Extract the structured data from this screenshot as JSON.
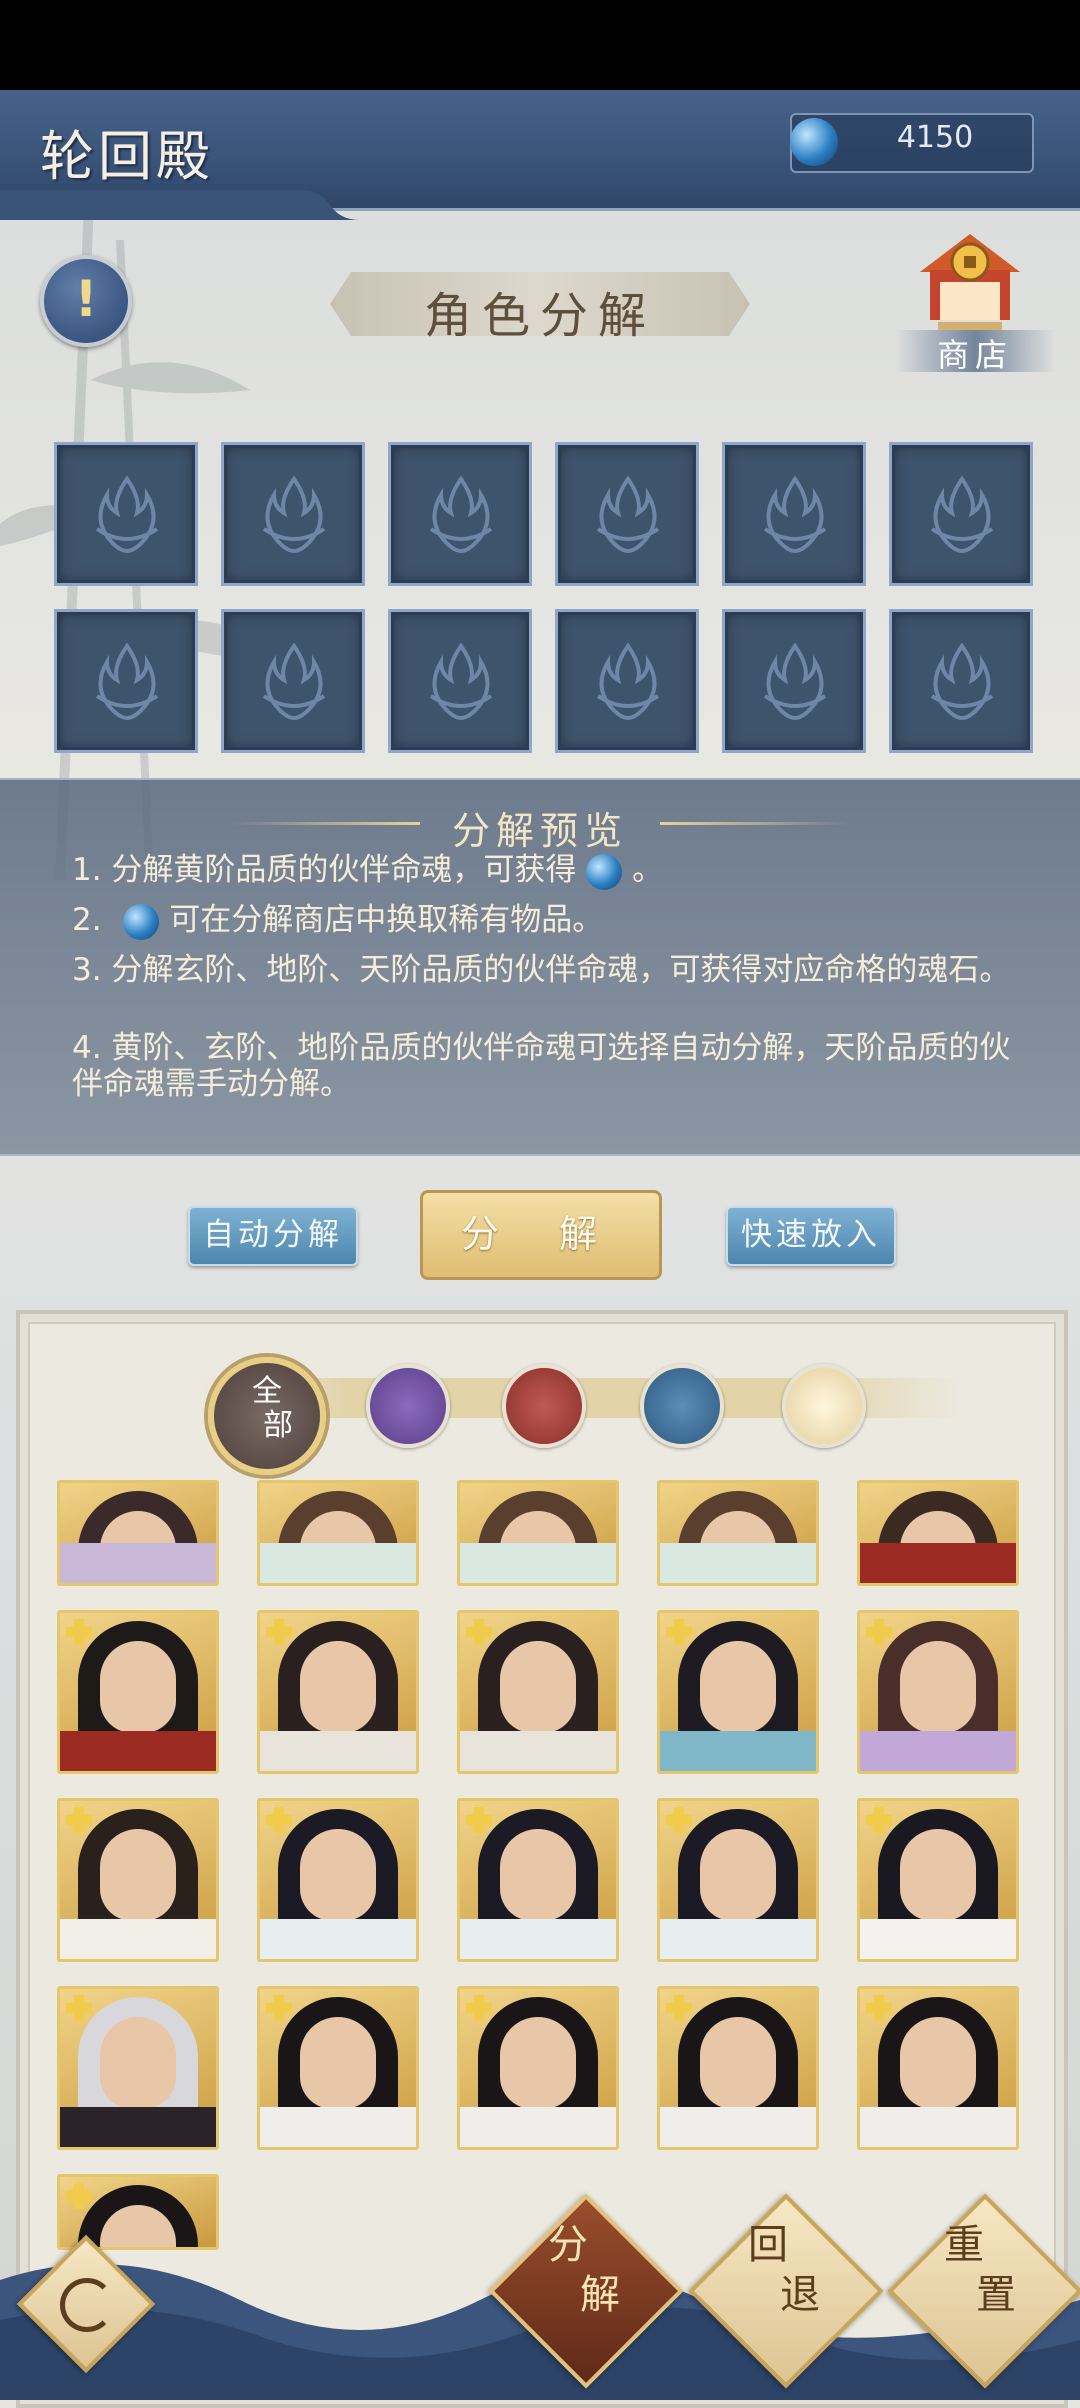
{
  "header": {
    "title": "轮回殿",
    "currency_value": "4150"
  },
  "info_button": {
    "glyph": "!"
  },
  "section_title": "角色分解",
  "shop": {
    "label": "商店"
  },
  "slots_count": 12,
  "preview": {
    "title": "分解预览",
    "line1_a": "1. 分解黄阶品质的伙伴命魂，可获得",
    "line1_b": "。",
    "line2_a": "2.",
    "line2_b": "可在分解商店中换取稀有物品。",
    "line3": "3. 分解玄阶、地阶、天阶品质的伙伴命魂，可获得对应命格的魂石。",
    "line4": "4. 黄阶、玄阶、地阶品质的伙伴命魂可选择自动分解，天阶品质的伙伴命魂需手动分解。"
  },
  "buttons": {
    "auto_decompose": "自动分解",
    "decompose": "分 解",
    "quick_add": "快速放入"
  },
  "filters": {
    "all_label_top": "全",
    "all_label_bottom": "部",
    "items": [
      "filter-purple-icon",
      "filter-red-fire-icon",
      "filter-blue-wave-icon",
      "filter-gold-sun-icon"
    ]
  },
  "colors": {
    "purple": "#6b4f9a",
    "red": "#9e3d3a",
    "blue": "#3f6e96",
    "gold": "#e9d7a8"
  },
  "bottom_actions": {
    "decompose_top": "分",
    "decompose_bottom": "解",
    "undo_top": "回",
    "undo_bottom": "退",
    "reset_top": "重",
    "reset_bottom": "置"
  }
}
